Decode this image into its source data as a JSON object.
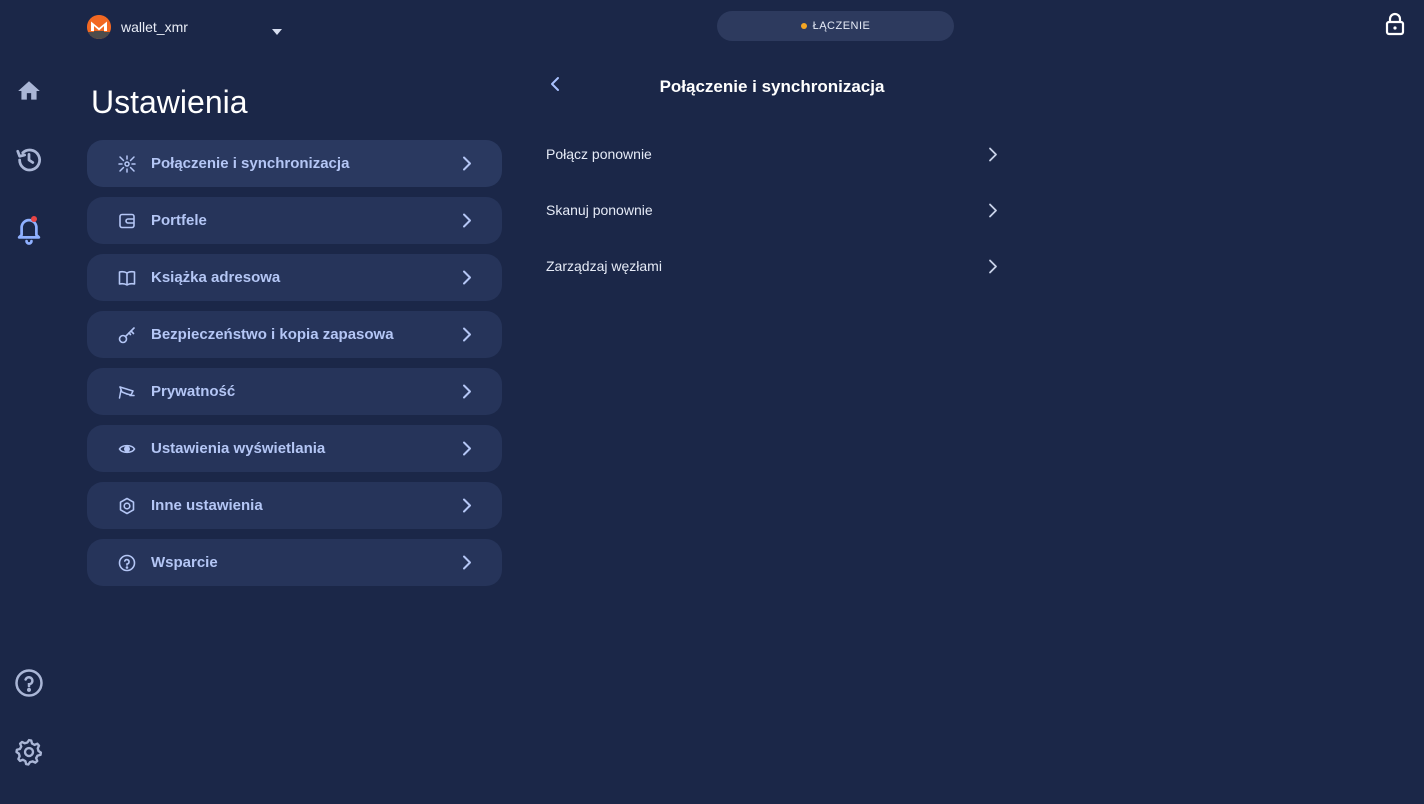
{
  "header": {
    "wallet_name": "wallet_xmr",
    "status_text": "ŁĄCZENIE",
    "status_color": "#f5a623"
  },
  "rail": {
    "items": [
      {
        "name": "home-icon"
      },
      {
        "name": "history-icon"
      },
      {
        "name": "bell-icon",
        "badge_color": "#e84545"
      },
      {
        "name": "help-icon"
      },
      {
        "name": "gear-icon"
      }
    ]
  },
  "settings": {
    "title": "Ustawienia",
    "items": [
      {
        "label": "Połączenie i synchronizacja",
        "icon": "network-icon"
      },
      {
        "label": "Portfele",
        "icon": "wallet-icon"
      },
      {
        "label": "Książka adresowa",
        "icon": "book-icon"
      },
      {
        "label": "Bezpieczeństwo i kopia zapasowa",
        "icon": "key-icon"
      },
      {
        "label": "Prywatność",
        "icon": "privacy-icon"
      },
      {
        "label": "Ustawienia wyświetlania",
        "icon": "eye-icon"
      },
      {
        "label": "Inne ustawienia",
        "icon": "hexagon-icon"
      },
      {
        "label": "Wsparcie",
        "icon": "question-icon"
      }
    ]
  },
  "detail": {
    "title": "Połączenie i synchronizacja",
    "items": [
      {
        "label": "Połącz ponownie"
      },
      {
        "label": "Skanuj ponownie"
      },
      {
        "label": "Zarządzaj węzłami"
      }
    ]
  },
  "colors": {
    "background": "#1b2748",
    "card": "#26345a",
    "accent_text": "#b4c6f5",
    "monero_orange": "#f26822"
  }
}
